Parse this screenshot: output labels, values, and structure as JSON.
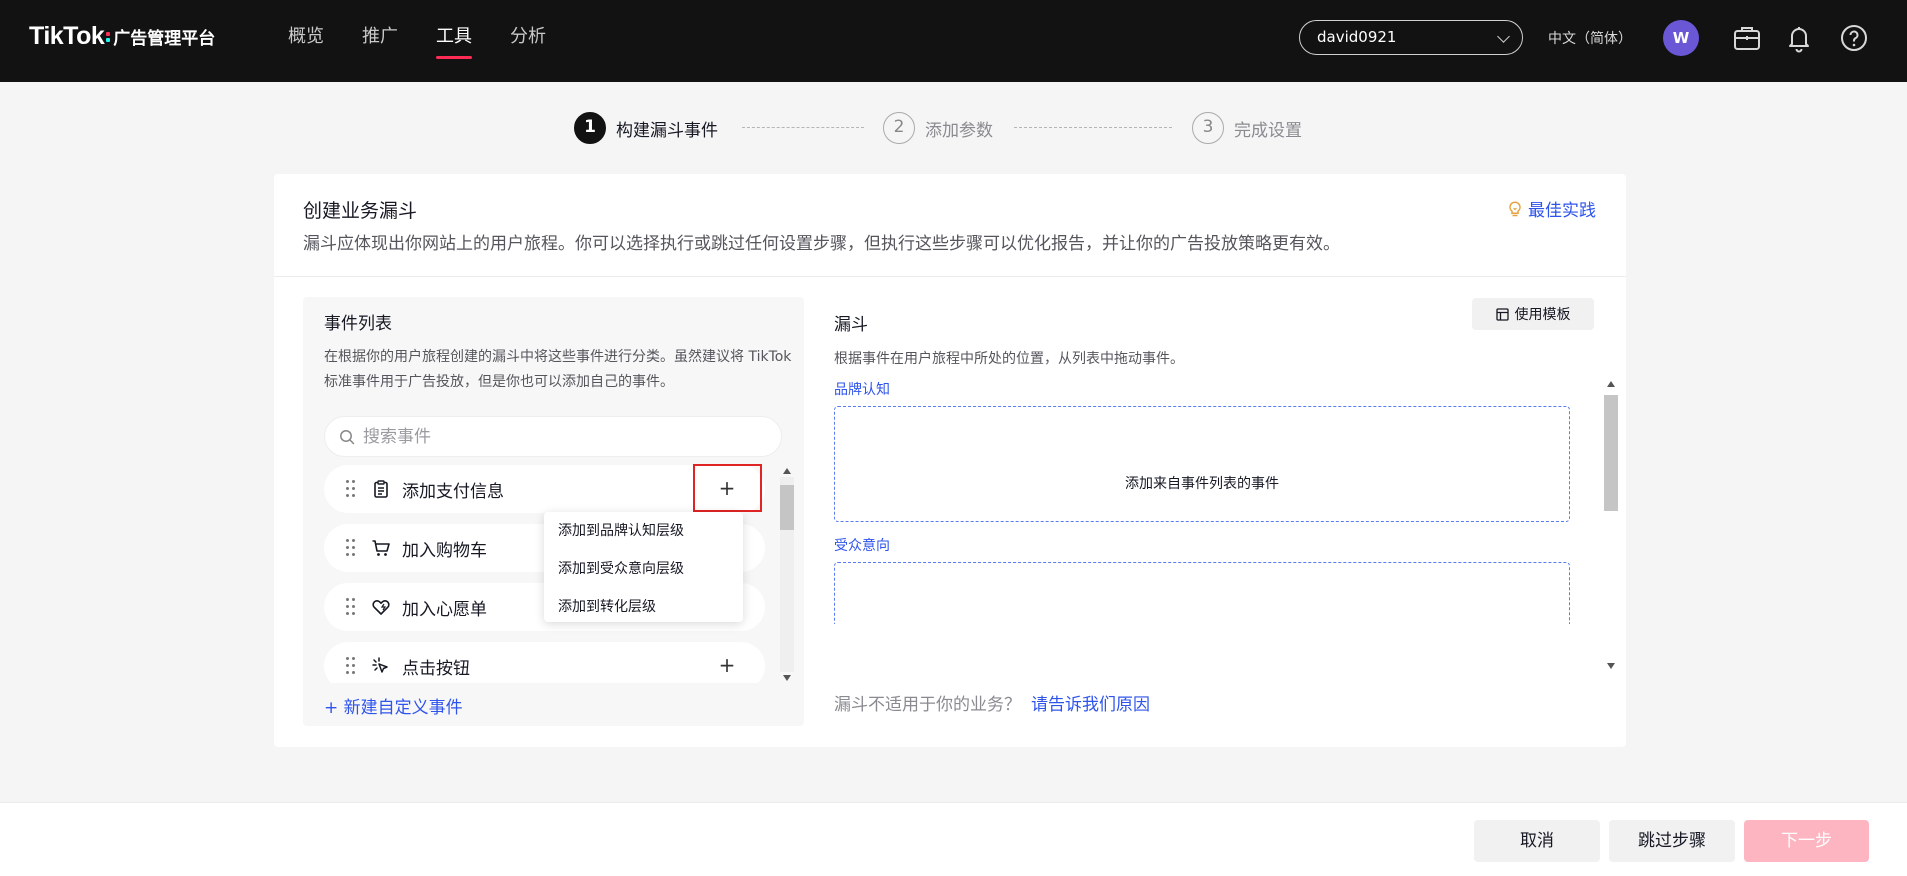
{
  "topbar": {
    "brand": "TikTok",
    "brand_sub": "广告管理平台",
    "nav": [
      {
        "label": "概览",
        "active": false
      },
      {
        "label": "推广",
        "active": false
      },
      {
        "label": "工具",
        "active": true
      },
      {
        "label": "分析",
        "active": false
      }
    ],
    "account": "david0921",
    "language": "中文（简体）",
    "avatar_initial": "W",
    "icons": [
      "briefcase-icon",
      "bell-icon",
      "help-icon"
    ]
  },
  "stepper": [
    {
      "num": "1",
      "label": "构建漏斗事件",
      "active": true
    },
    {
      "num": "2",
      "label": "添加参数",
      "active": false
    },
    {
      "num": "3",
      "label": "完成设置",
      "active": false
    }
  ],
  "card": {
    "title": "创建业务漏斗",
    "desc": "漏斗应体现出你网站上的用户旅程。你可以选择执行或跳过任何设置步骤，但执行这些步骤可以优化报告，并让你的广告投放策略更有效。",
    "best_practice": "最佳实践"
  },
  "events_panel": {
    "title": "事件列表",
    "desc": "在根据你的用户旅程创建的漏斗中将这些事件进行分类。虽然建议将 TikTok 标准事件用于广告投放，但是你也可以添加自己的事件。",
    "search_placeholder": "搜索事件",
    "items": [
      {
        "label": "添加支付信息",
        "icon": "clipboard-icon"
      },
      {
        "label": "加入购物车",
        "icon": "cart-icon"
      },
      {
        "label": "加入心愿单",
        "icon": "heart-icon"
      },
      {
        "label": "点击按钮",
        "icon": "click-icon"
      }
    ],
    "plus": "+",
    "new_event": "+ 新建自定义事件"
  },
  "add_menu": {
    "items": [
      "添加到品牌认知层级",
      "添加到受众意向层级",
      "添加到转化层级"
    ]
  },
  "funnel_panel": {
    "title": "漏斗",
    "desc": "根据事件在用户旅程中所处的位置，从列表中拖动事件。",
    "template_button": "使用模板",
    "stages": [
      {
        "label": "品牌认知",
        "hint": "添加来自事件列表的事件"
      },
      {
        "label": "受众意向",
        "hint": ""
      }
    ],
    "footer_text": "漏斗不适用于你的业务？",
    "footer_link": "请告诉我们原因"
  },
  "footer": {
    "cancel": "取消",
    "skip": "跳过步骤",
    "next": "下一步"
  },
  "colors": {
    "accent": "#2f54eb",
    "brand_red": "#fe2c55",
    "next_disabled": "#fdb6c1",
    "topbar": "#121212"
  }
}
